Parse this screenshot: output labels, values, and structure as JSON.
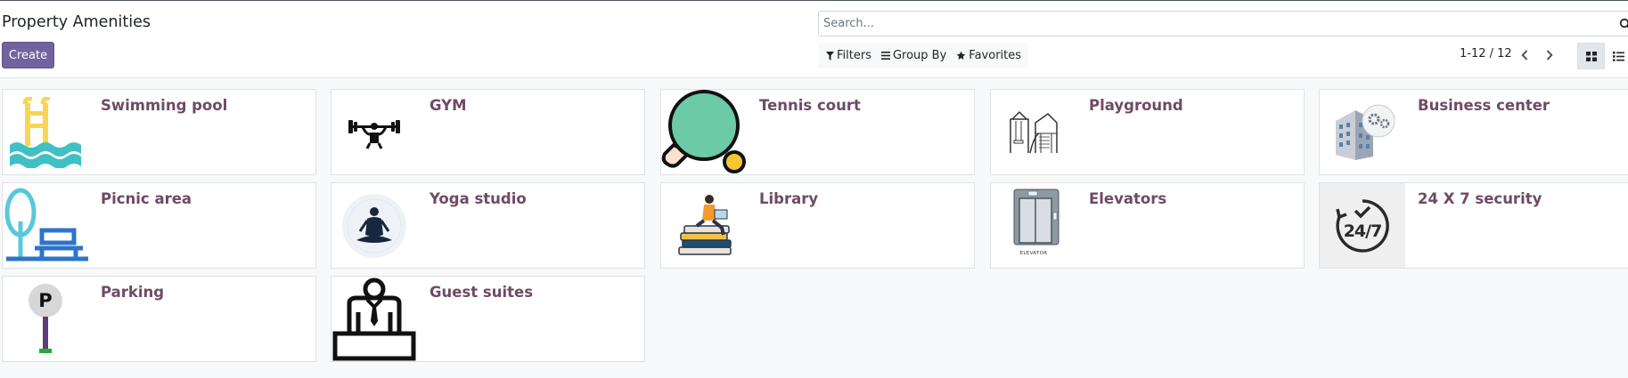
{
  "header": {
    "title": "Property Amenities",
    "create_label": "Create"
  },
  "search": {
    "placeholder": "Search...",
    "value": ""
  },
  "filters": {
    "filters_label": "Filters",
    "groupby_label": "Group By",
    "favorites_label": "Favorites"
  },
  "pager": {
    "value": "1-12 / 12"
  },
  "colors": {
    "brand": "#71639e",
    "card_title": "#6f4a66",
    "background": "#f8f9fa"
  },
  "amenities": [
    {
      "name": "Swimming pool",
      "icon": "swimming-pool-icon"
    },
    {
      "name": "GYM",
      "icon": "weightlifter-icon"
    },
    {
      "name": "Tennis court",
      "icon": "ping-pong-paddle-icon"
    },
    {
      "name": "Playground",
      "icon": "playground-slide-icon"
    },
    {
      "name": "Business center",
      "icon": "office-building-gear-icon"
    },
    {
      "name": "Picnic area",
      "icon": "tree-bench-icon"
    },
    {
      "name": "Yoga studio",
      "icon": "meditation-icon"
    },
    {
      "name": "Library",
      "icon": "reader-on-books-icon"
    },
    {
      "name": "Elevators",
      "icon": "elevator-icon",
      "caption": "ELEVATOR"
    },
    {
      "name": "24 X 7 security",
      "icon": "24-7-clock-icon",
      "badge": "24/7"
    },
    {
      "name": "Parking",
      "icon": "parking-sign-icon",
      "sign_letter": "P"
    },
    {
      "name": "Guest suites",
      "icon": "receptionist-desk-icon"
    }
  ]
}
